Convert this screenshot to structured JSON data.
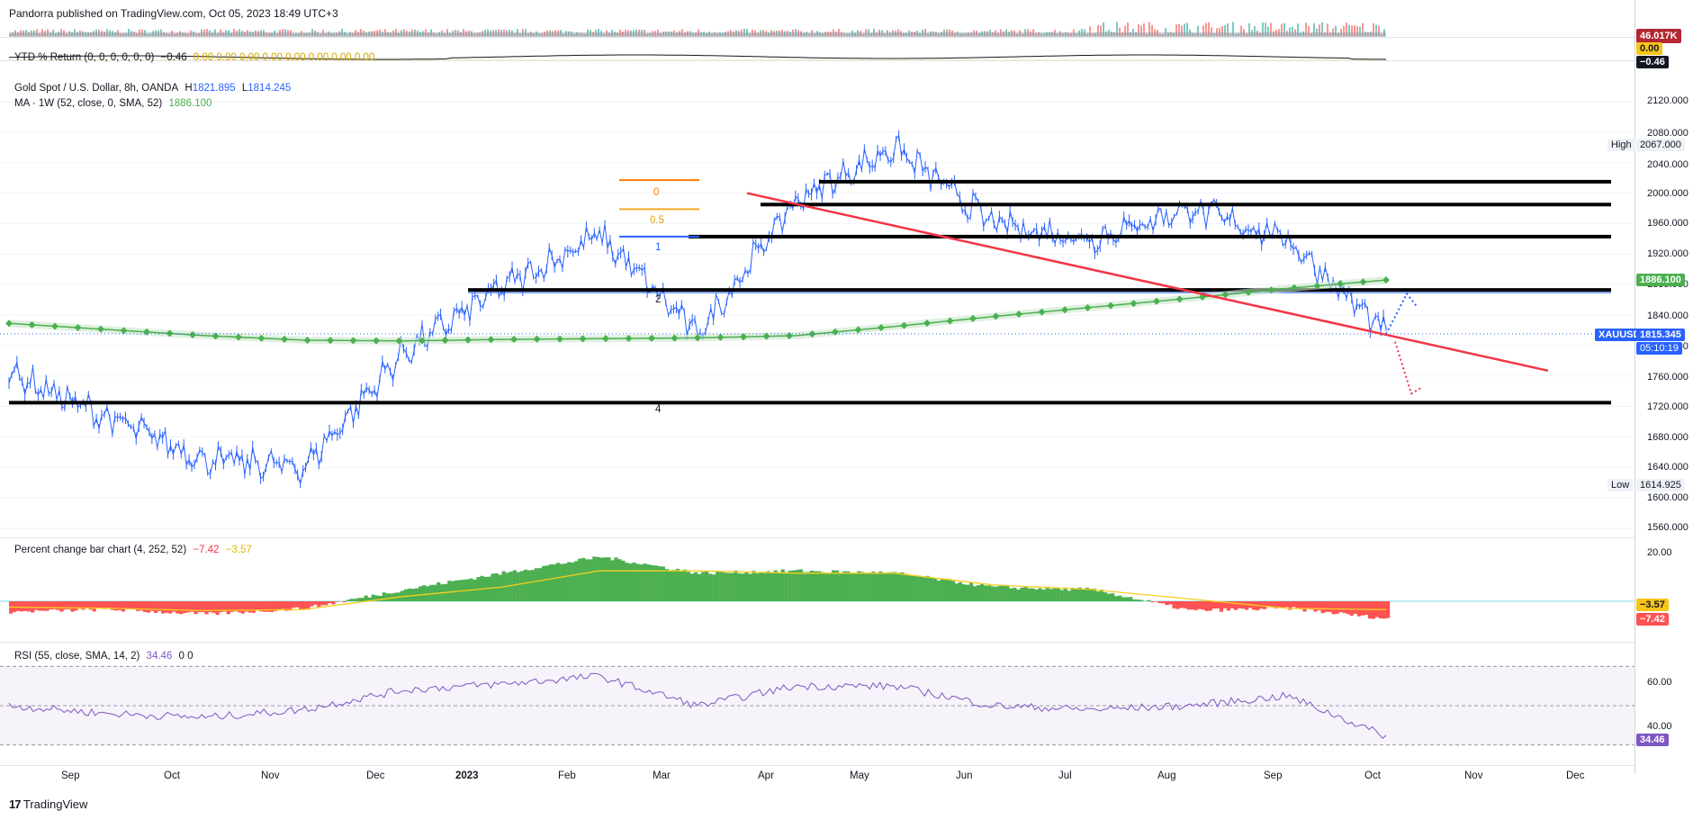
{
  "publisher": "Pandorra published on TradingView.com, Oct 05, 2023 18:49 UTC+3",
  "footer_brand": "TradingView",
  "footer_logo": "17",
  "colors": {
    "up": "#2962ff",
    "ma": "#4caf50",
    "trend": "#f23645",
    "pos": "#4caf50",
    "neg": "#ff5252",
    "rsi": "#7e57c2",
    "signal": "#f5d020"
  },
  "volume_pane": {
    "badge": "46.017K"
  },
  "ytd_pane": {
    "legend": "YTD % Return (0, 0, 0, 0, 0, 0)",
    "legend_value": "−0.46",
    "legend_zeros": "0.00  0.00  0.00  0.00  0.00  0.00  0.00  0.00",
    "badge_top": "0.00",
    "badge_bottom": "−0.46"
  },
  "price_pane": {
    "title": "Gold Spot / U.S. Dollar, 8h, OANDA",
    "high_label": "H",
    "high_value": "1821.895",
    "low_label": "L",
    "low_value": "1814.245",
    "ma_legend": "MA · 1W (52, close, 0, SMA, 52)",
    "ma_value": "1886.100",
    "ticks": [
      "2120.000",
      "2080.000",
      "2040.000",
      "2000.000",
      "1960.000",
      "1920.000",
      "1880.000",
      "1840.000",
      "1800.000",
      "1760.000",
      "1720.000",
      "1680.000",
      "1640.000",
      "1600.000",
      "1560.000"
    ],
    "high_tag": "High",
    "high_tag_value": "2067.000",
    "low_tag": "Low",
    "low_tag_value": "1614.925",
    "ma_badge": "1886.100",
    "symbol_badge": "XAUUSD",
    "price_badge": "1815.345",
    "countdown": "05:10:19",
    "fib_labels": [
      "0",
      "0.5",
      "1"
    ],
    "level_labels": [
      "2",
      "4"
    ]
  },
  "pct_pane": {
    "legend": "Percent change bar chart (4, 252, 52)",
    "v1": "−7.42",
    "v2": "−3.57",
    "tick": "20.00",
    "badge1": "−3.57",
    "badge2": "−7.42"
  },
  "rsi_pane": {
    "legend": "RSI (55, close, SMA, 14, 2)",
    "value": "34.46",
    "zeros": "0  0",
    "ticks": [
      "60.00",
      "40.00"
    ],
    "badge": "34.46"
  },
  "x_labels": [
    "Sep",
    "Oct",
    "Nov",
    "Dec",
    "2023",
    "Feb",
    "Mar",
    "Apr",
    "May",
    "Jun",
    "Jul",
    "Aug",
    "Sep",
    "Oct",
    "Nov",
    "Dec"
  ],
  "chart_data": [
    {
      "type": "line",
      "title": "Gold Spot / U.S. Dollar, 8h, OANDA",
      "x": [
        "Aug 2022",
        "Sep 2022",
        "Oct 2022",
        "Nov 2022",
        "Dec 2022",
        "Jan 2023",
        "Feb 2023",
        "Mar 2023",
        "Apr 2023",
        "May 2023",
        "Jun 2023",
        "Jul 2023",
        "Aug 2023",
        "Sep 2023",
        "Oct 2023"
      ],
      "series": [
        {
          "name": "XAUUSD",
          "values": [
            1765,
            1705,
            1650,
            1640,
            1790,
            1875,
            1945,
            1815,
            1990,
            2060,
            1960,
            1940,
            1980,
            1940,
            1815
          ]
        },
        {
          "name": "MA",
          "values": [
            1829,
            1821,
            1813,
            1807,
            1806,
            1808,
            1809,
            1810,
            1813,
            1825,
            1838,
            1850,
            1862,
            1875,
            1886
          ]
        }
      ],
      "ylim": [
        1540,
        2150
      ],
      "horizontal_levels": [
        2015,
        1985,
        1943,
        1873,
        1725
      ],
      "fib_levels": [
        {
          "label": "0",
          "value": 2017
        },
        {
          "label": "0.5",
          "value": 1979
        },
        {
          "label": "1",
          "value": 1943
        }
      ],
      "projections": {
        "up_target": 1868,
        "down_target": 1737
      }
    },
    {
      "type": "area",
      "title": "Percent change bar chart (4, 252, 52)",
      "x": [
        "Aug 2022",
        "Sep 2022",
        "Oct 2022",
        "Nov 2022",
        "Dec 2022",
        "Jan 2023",
        "Feb 2023",
        "Mar 2023",
        "Apr 2023",
        "May 2023",
        "Jun 2023",
        "Jul 2023",
        "Aug 2023",
        "Sep 2023",
        "Oct 2023"
      ],
      "series": [
        {
          "name": "% change",
          "values": [
            -4.5,
            -3.5,
            -5.5,
            -3,
            5,
            12,
            19,
            12,
            13,
            12,
            6,
            5,
            -4,
            -3,
            -7.42
          ]
        },
        {
          "name": "signal",
          "values": [
            -2.5,
            -3,
            -4,
            -3.5,
            2,
            6,
            13,
            13,
            12,
            12,
            7,
            5,
            1,
            -3,
            -3.57
          ]
        }
      ]
    },
    {
      "type": "line",
      "title": "RSI (55, close, SMA, 14, 2)",
      "x": [
        "Aug 2022",
        "Sep 2022",
        "Oct 2022",
        "Nov 2022",
        "Dec 2022",
        "Jan 2023",
        "Feb 2023",
        "Mar 2023",
        "Apr 2023",
        "May 2023",
        "Jun 2023",
        "Jul 2023",
        "Aug 2023",
        "Sep 2023",
        "Oct 2023"
      ],
      "series": [
        {
          "name": "RSI",
          "values": [
            50,
            46,
            44,
            48,
            58,
            61,
            65,
            50,
            60,
            60,
            50,
            48,
            50,
            55,
            34.46
          ]
        }
      ],
      "ylim": [
        28,
        72
      ]
    }
  ]
}
